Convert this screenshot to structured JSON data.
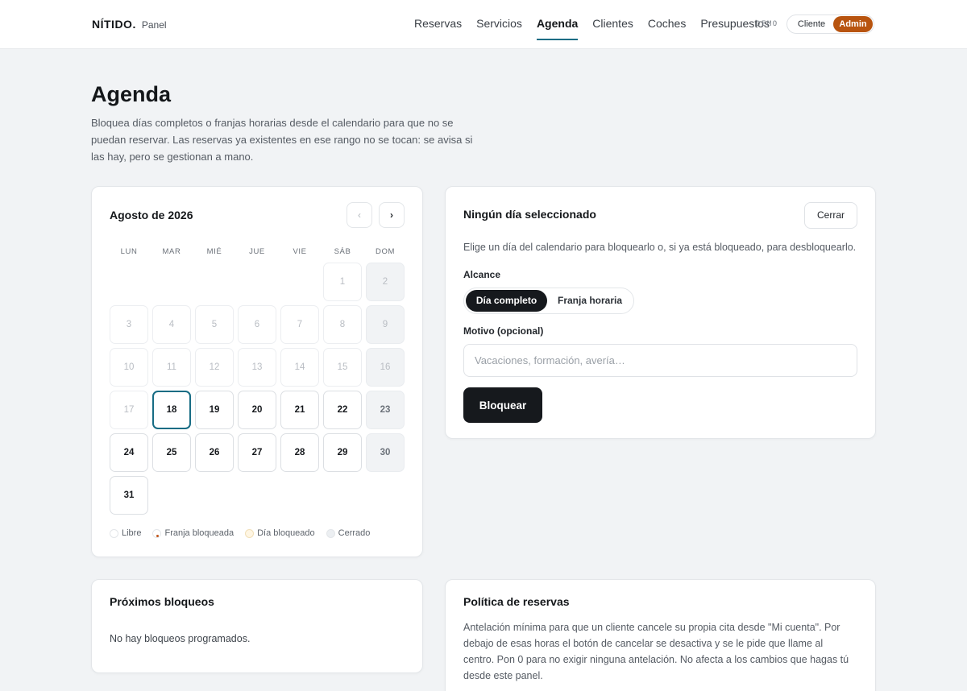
{
  "brand": {
    "name": "NÍTIDO.",
    "sub": "Panel"
  },
  "nav": {
    "items": [
      "Reservas",
      "Servicios",
      "Agenda",
      "Clientes",
      "Coches",
      "Presupuestos"
    ],
    "active_index": 2,
    "demo_tag": "DEMO",
    "role_cliente": "Cliente",
    "role_admin": "Admin",
    "active_role": "Admin"
  },
  "header": {
    "title": "Agenda",
    "description": "Bloquea días completos o franjas horarias desde el calendario para que no se puedan reservar. Las reservas ya existentes en ese rango no se tocan: se avisa si las hay, pero se gestionan a mano."
  },
  "calendar": {
    "month_label": "Agosto de 2026",
    "prev_glyph": "‹",
    "next_glyph": "›",
    "weekdays": [
      "LUN",
      "MAR",
      "MIÉ",
      "JUE",
      "VIE",
      "SÁB",
      "DOM"
    ],
    "first_weekday_index": 5,
    "days_in_month": 31,
    "today": 18,
    "past_before": 18,
    "closed_weekdays": [
      6
    ],
    "legend": {
      "libre": "Libre",
      "franja": "Franja bloqueada",
      "dia": "Día bloqueado",
      "cerrado": "Cerrado"
    }
  },
  "side_panel": {
    "title": "Ningún día seleccionado",
    "close_label": "Cerrar",
    "help": "Elige un día del calendario para bloquearlo o, si ya está bloqueado, para desbloquearlo.",
    "scope_label": "Alcance",
    "scope_full": "Día completo",
    "scope_slot": "Franja horaria",
    "scope_selected": "Día completo",
    "reason_label": "Motivo (opcional)",
    "reason_placeholder": "Vacaciones, formación, avería…",
    "reason_value": "",
    "block_label": "Bloquear"
  },
  "upcoming": {
    "title": "Próximos bloqueos",
    "empty": "No hay bloqueos programados."
  },
  "policy": {
    "title": "Política de reservas",
    "text": "Antelación mínima para que un cliente cancele su propia cita desde \"Mi cuenta\". Por debajo de esas horas el botón de cancelar se desactiva y se le pide que llame al centro. Pon 0 para no exigir ninguna antelación. No afecta a los cambios que hagas tú desde este panel."
  },
  "colors": {
    "accent": "#176c84",
    "admin": "#b8540f",
    "dark": "#16191d",
    "franja_dot": "#c2551a",
    "dia_dot": "#fff6e3"
  }
}
